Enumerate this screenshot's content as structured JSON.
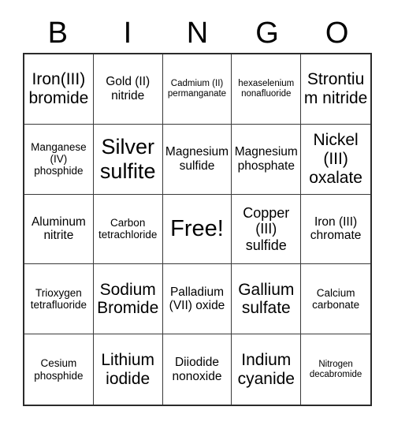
{
  "header": {
    "letters": [
      "B",
      "I",
      "N",
      "G",
      "O"
    ]
  },
  "grid": {
    "rows": 5,
    "columns": 5,
    "cells": [
      {
        "text": "Iron(III) bromide",
        "size": "xl"
      },
      {
        "text": "Gold (II) nitride",
        "size": "md"
      },
      {
        "text": "Cadmium (II) permanganate",
        "size": "xs"
      },
      {
        "text": "hexaselenium nonafluoride",
        "size": "xs"
      },
      {
        "text": "Strontium nitride",
        "size": "xl"
      },
      {
        "text": "Manganese (IV) phosphide",
        "size": "sm"
      },
      {
        "text": "Silver sulfite",
        "size": "xxl"
      },
      {
        "text": "Magnesium sulfide",
        "size": "md"
      },
      {
        "text": "Magnesium phosphate",
        "size": "md"
      },
      {
        "text": "Nickel (III) oxalate",
        "size": "xl"
      },
      {
        "text": "Aluminum nitrite",
        "size": "md"
      },
      {
        "text": "Carbon tetrachloride",
        "size": "sm"
      },
      {
        "text": "Free!",
        "size": "free"
      },
      {
        "text": "Copper (III) sulfide",
        "size": "lg"
      },
      {
        "text": "Iron (III) chromate",
        "size": "md"
      },
      {
        "text": "Trioxygen tetrafluoride",
        "size": "sm"
      },
      {
        "text": "Sodium Bromide",
        "size": "xl"
      },
      {
        "text": "Palladium (VII) oxide",
        "size": "md"
      },
      {
        "text": "Gallium sulfate",
        "size": "xl"
      },
      {
        "text": "Calcium carbonate",
        "size": "sm"
      },
      {
        "text": "Cesium phosphide",
        "size": "sm"
      },
      {
        "text": "Lithium iodide",
        "size": "xl"
      },
      {
        "text": "Diiodide nonoxide",
        "size": "md"
      },
      {
        "text": "Indium cyanide",
        "size": "xl"
      },
      {
        "text": "Nitrogen decabromide",
        "size": "xs"
      }
    ]
  }
}
